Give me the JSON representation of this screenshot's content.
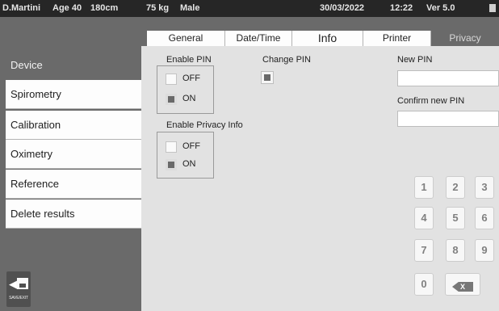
{
  "header": {
    "patient": "D.Martini",
    "age": "Age 40",
    "height": "180cm",
    "weight": "75 kg",
    "sex": "Male",
    "date": "30/03/2022",
    "time": "12:22",
    "version": "Ver 5.0"
  },
  "sidebar": {
    "items": [
      {
        "label": "Device",
        "active": true
      },
      {
        "label": "Spirometry",
        "active": false
      },
      {
        "label": "Calibration",
        "active": false
      },
      {
        "label": "Oximetry",
        "active": false
      },
      {
        "label": "Reference",
        "active": false
      },
      {
        "label": "Delete  results",
        "active": false
      }
    ],
    "save_exit_label": "SAVE/EXIT"
  },
  "tabs": [
    {
      "label": "General",
      "active": false
    },
    {
      "label": "Date/Time",
      "active": false
    },
    {
      "label": "Info",
      "active": false
    },
    {
      "label": "Printer",
      "active": false
    },
    {
      "label": "Privacy",
      "active": true
    }
  ],
  "privacy": {
    "enable_pin": {
      "title": "Enable PIN",
      "options": [
        {
          "label": "OFF",
          "selected": false
        },
        {
          "label": "ON",
          "selected": true
        }
      ]
    },
    "change_pin": {
      "title": "Change PIN",
      "checked": true
    },
    "enable_privacy_info": {
      "title": "Enable Privacy Info",
      "options": [
        {
          "label": "OFF",
          "selected": false
        },
        {
          "label": "ON",
          "selected": true
        }
      ]
    },
    "new_pin": {
      "label": "New PIN",
      "value": ""
    },
    "confirm_pin": {
      "label": "Confirm new  PIN",
      "value": ""
    }
  },
  "keypad": {
    "keys": [
      "1",
      "2",
      "3",
      "4",
      "5",
      "6",
      "7",
      "8",
      "9",
      "0"
    ],
    "clear_label": "X"
  },
  "colors": {
    "header_bg": "#262626",
    "panel_gray": "#6a6a6a",
    "content_bg": "#e2e2e2",
    "tile_bg": "#fdfdfd",
    "key_text": "#808080"
  }
}
